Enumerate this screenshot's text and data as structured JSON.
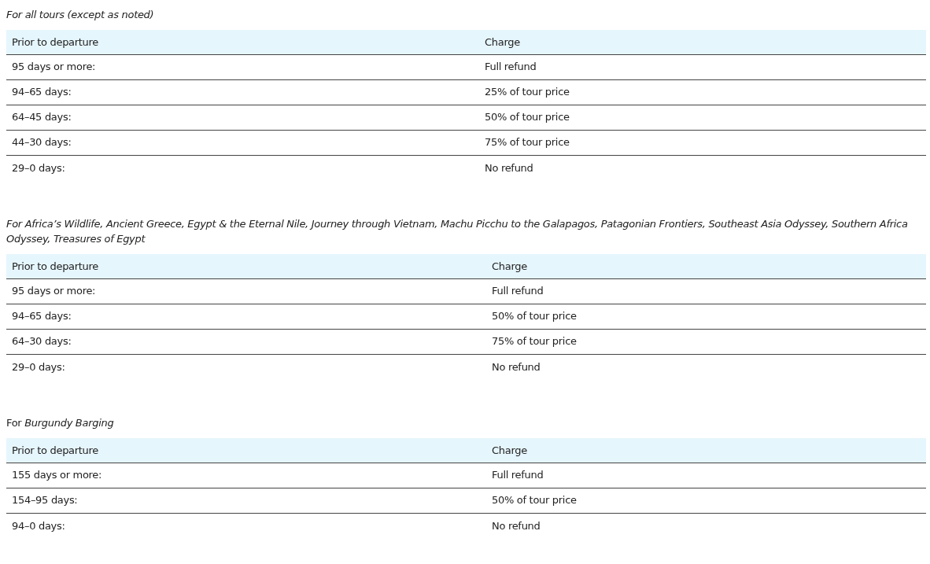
{
  "sections": [
    {
      "caption": {
        "text": "For all tours (except as noted)",
        "italic": true
      },
      "columns": [
        "Prior to departure",
        "Charge"
      ],
      "rows": [
        [
          "95 days or more:",
          "Full refund"
        ],
        [
          "94–65 days:",
          "25% of tour price"
        ],
        [
          "64–45 days:",
          "50% of tour price"
        ],
        [
          "44–30 days:",
          "75% of tour price"
        ],
        [
          "29–0 days:",
          "No refund"
        ]
      ]
    },
    {
      "caption": {
        "text": "For Africa’s Wildlife, Ancient Greece, Egypt & the Eternal Nile, Journey through Vietnam, Machu Picchu to the Galapagos, Patagonian Frontiers, Southeast Asia Odyssey, Southern Africa Odyssey, Treasures of Egypt",
        "italic": true
      },
      "columns": [
        "Prior to departure",
        "Charge"
      ],
      "rows": [
        [
          "95 days or more:",
          "Full refund"
        ],
        [
          "94–65 days:",
          "50% of tour price"
        ],
        [
          "64–30 days:",
          "75% of tour price"
        ],
        [
          "29–0 days:",
          "No refund"
        ]
      ]
    },
    {
      "caption": {
        "text": "For *Burgundy Barging*",
        "italic": false
      },
      "columns": [
        "Prior to departure",
        "Charge"
      ],
      "rows": [
        [
          "155 days or more:",
          "Full refund"
        ],
        [
          "154–95 days:",
          "50% of tour price"
        ],
        [
          "94–0 days:",
          "No refund"
        ]
      ]
    }
  ]
}
